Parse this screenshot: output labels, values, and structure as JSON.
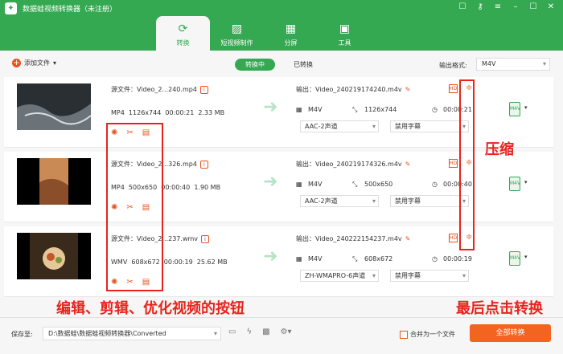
{
  "app": {
    "title": "数据蛙视频转换器（未注册）"
  },
  "window_controls": [
    "☐",
    "⚷",
    "≡",
    "–",
    "☐",
    "✕"
  ],
  "tabs": [
    {
      "label": "转换",
      "icon": "convert-icon"
    },
    {
      "label": "短视频制作",
      "icon": "image-icon"
    },
    {
      "label": "分屏",
      "icon": "split-screen-icon"
    },
    {
      "label": "工具",
      "icon": "toolbox-icon"
    }
  ],
  "toolbar": {
    "add_file": "添加文件",
    "status_converting": "转换中",
    "status_done": "已转换",
    "output_format_label": "输出格式:",
    "output_format_value": "M4V"
  },
  "rows": [
    {
      "source": "源文件：Video_2...240.mp4",
      "format": "MP4",
      "resolution": "1126x744",
      "duration": "00:00:21",
      "size": "2.33 MB",
      "output": "输出：Video_240219174240.m4v",
      "out_format": "M4V",
      "out_resolution": "1126x744",
      "out_duration": "00:00:21",
      "audio": "AAC-2声道",
      "subtitle": "禁用字幕"
    },
    {
      "source": "源文件：Video_2...326.mp4",
      "format": "MP4",
      "resolution": "500x650",
      "duration": "00:00:40",
      "size": "1.90 MB",
      "output": "输出：Video_240219174326.m4v",
      "out_format": "M4V",
      "out_resolution": "500x650",
      "out_duration": "00:00:40",
      "audio": "AAC-2声道",
      "subtitle": "禁用字幕"
    },
    {
      "source": "源文件：Video_2...237.wmv",
      "format": "WMV",
      "resolution": "608x672",
      "duration": "00:00:19",
      "size": "25.62 MB",
      "output": "输出：Video_240222154237.m4v",
      "out_format": "M4V",
      "out_resolution": "608x672",
      "out_duration": "00:00:19",
      "audio": "ZH-WMAPRO-6声道",
      "subtitle": "禁用字幕"
    }
  ],
  "annotations": {
    "compress": "压缩",
    "edit_buttons": "编辑、剪辑、优化视频的按钮",
    "final_convert": "最后点击转换"
  },
  "bottom": {
    "save_to_label": "保存至:",
    "save_path": "D:\\数据蛙\\数据蛙视频转换器\\Converted",
    "merge_label": "合并为一个文件",
    "convert_all": "全部转换"
  },
  "colors": {
    "brand": "#35a852",
    "accent": "#f2641f",
    "annotation": "#e8231d"
  }
}
